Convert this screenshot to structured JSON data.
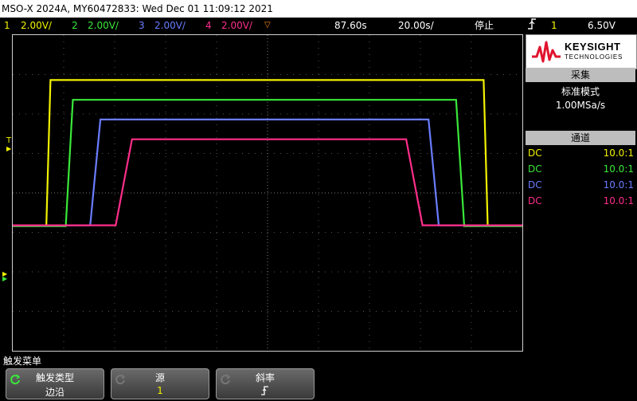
{
  "title_bar": {
    "text": "MSO-X 2024A, MY60472833: Wed Dec 01 11:09:12 2021"
  },
  "channel_bar": {
    "channels": [
      {
        "num": "1",
        "scale": "2.00V/",
        "color": "#f2f200"
      },
      {
        "num": "2",
        "scale": "2.00V/",
        "color": "#3ae83a"
      },
      {
        "num": "3",
        "scale": "2.00V/",
        "color": "#6a7dff"
      },
      {
        "num": "4",
        "scale": "2.00V/",
        "color": "#ff2e8a"
      }
    ],
    "delay": "87.60s",
    "timebase": "20.00s/",
    "run_state": "停止",
    "trigger_icon": "edge-trigger-icon",
    "trigger_source": "1",
    "trigger_level": "6.50V"
  },
  "sidebar": {
    "logo_line1": "KEYSIGHT",
    "logo_line2": "TECHNOLOGIES",
    "acquire_header": "采集",
    "acquire_mode": "标准模式",
    "sample_rate": "1.00MSa/s",
    "channels_header": "通道",
    "channel_rows": [
      {
        "coupling": "DC",
        "probe": "10.0:1",
        "color": "#f2f200"
      },
      {
        "coupling": "DC",
        "probe": "10.0:1",
        "color": "#3ae83a"
      },
      {
        "coupling": "DC",
        "probe": "10.0:1",
        "color": "#6a7dff"
      },
      {
        "coupling": "DC",
        "probe": "10.0:1",
        "color": "#ff2e8a"
      }
    ]
  },
  "trigger_marker": "T",
  "softkeys": {
    "menu_title": "触发菜单",
    "keys": [
      {
        "title": "触发类型",
        "value": "边沿",
        "value_color": "#ffffff"
      },
      {
        "title": "源",
        "value": "1",
        "value_color": "#f2f200"
      },
      {
        "title": "斜率",
        "value": "↗",
        "value_color": "#ffffff"
      }
    ]
  },
  "waveforms": {
    "x_range": [
      0,
      10
    ],
    "y_range": [
      -4,
      4
    ],
    "series": [
      {
        "color": "#f2f200",
        "points": [
          [
            0,
            -0.82
          ],
          [
            0.66,
            -0.82
          ],
          [
            0.74,
            2.86
          ],
          [
            9.24,
            2.86
          ],
          [
            9.32,
            -0.82
          ],
          [
            10,
            -0.82
          ]
        ]
      },
      {
        "color": "#3ae83a",
        "points": [
          [
            0,
            -0.84
          ],
          [
            1.04,
            -0.84
          ],
          [
            1.18,
            2.36
          ],
          [
            8.7,
            2.36
          ],
          [
            8.86,
            -0.84
          ],
          [
            10,
            -0.84
          ]
        ]
      },
      {
        "color": "#6a7dff",
        "points": [
          [
            0,
            -0.82
          ],
          [
            1.52,
            -0.82
          ],
          [
            1.72,
            1.86
          ],
          [
            8.16,
            1.86
          ],
          [
            8.36,
            -0.82
          ],
          [
            10,
            -0.82
          ]
        ]
      },
      {
        "color": "#ff2e8a",
        "points": [
          [
            0,
            -0.82
          ],
          [
            2.02,
            -0.82
          ],
          [
            2.34,
            1.36
          ],
          [
            7.72,
            1.36
          ],
          [
            8.04,
            -0.82
          ],
          [
            10,
            -0.82
          ]
        ]
      }
    ]
  }
}
